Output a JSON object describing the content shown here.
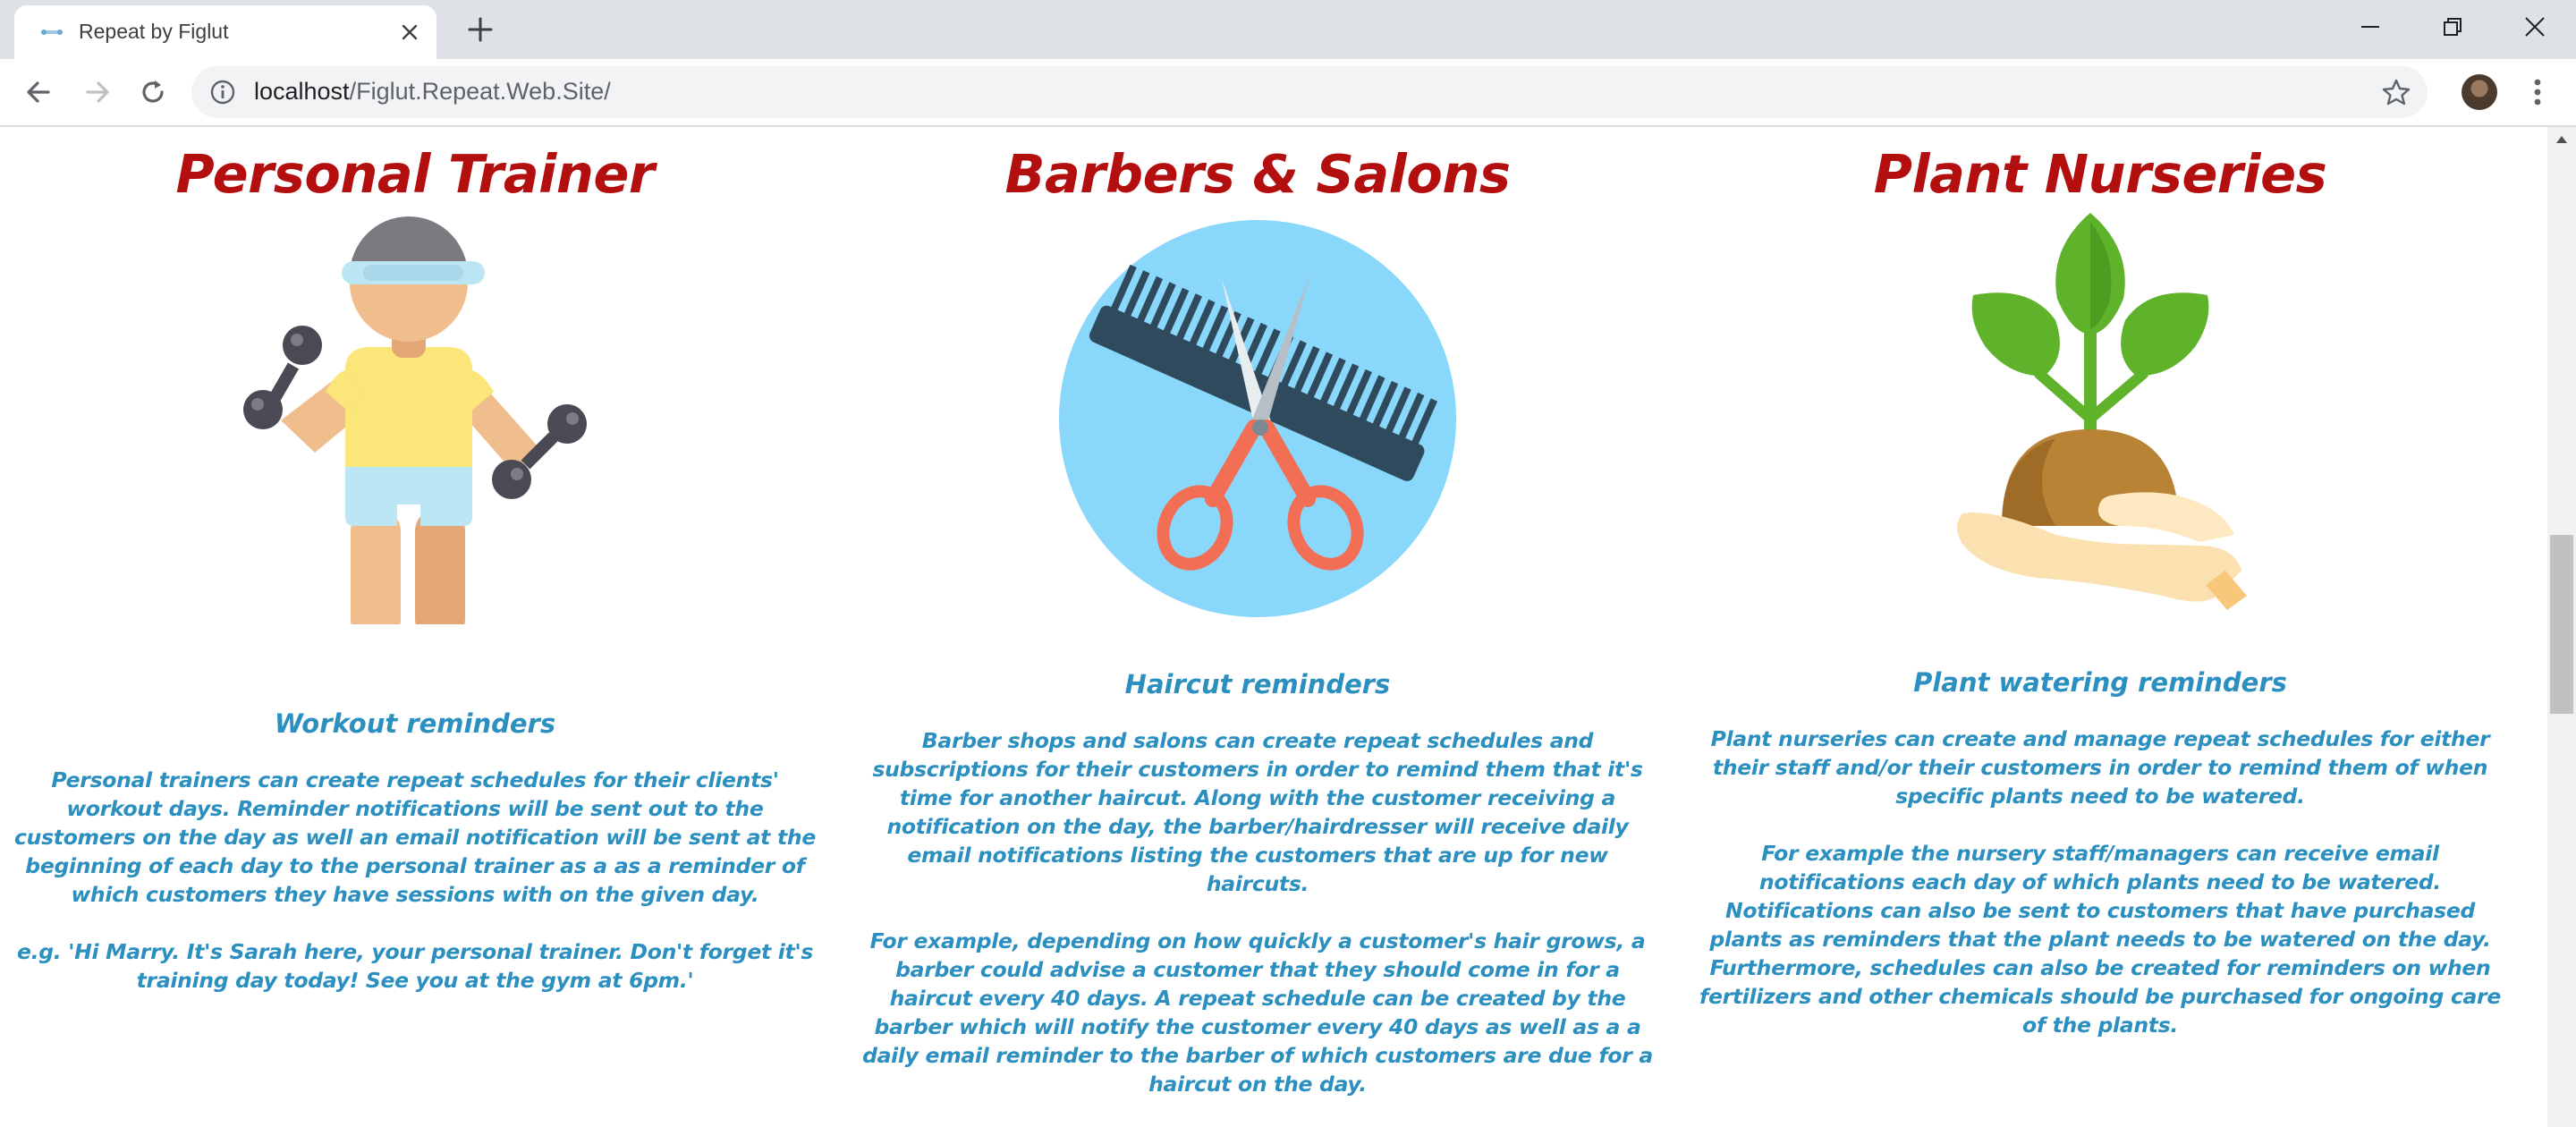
{
  "browser": {
    "tab_title": "Repeat by Figlut",
    "url_host": "localhost",
    "url_path": "/Figlut.Repeat.Web.Site/"
  },
  "sections": [
    {
      "title": "Personal Trainer",
      "illustration": "fitness-person-with-dumbbells-icon",
      "subtitle": "Workout reminders",
      "paragraphs": [
        "Personal trainers can create repeat schedules for their clients' workout days. Reminder notifications will be sent out to the customers on the day as well an email notification will be sent at the beginning of each day to the personal trainer as a as a reminder of which customers they have sessions with on the given day.",
        "e.g. 'Hi Marry. It's Sarah here, your personal trainer. Don't forget it's training day today! See you at the gym at 6pm.'"
      ]
    },
    {
      "title": "Barbers & Salons",
      "illustration": "comb-and-scissors-icon",
      "subtitle": "Haircut reminders",
      "paragraphs": [
        "Barber shops and salons can create repeat schedules and subscriptions for their customers in order to remind them that it's time for another haircut. Along with the customer receiving a notification on the day, the barber/hairdresser will receive daily email notifications listing the customers that are up for new haircuts.",
        "For example, depending on how quickly a customer's hair grows, a barber could advise a customer that they should come in for a haircut every 40 days. A repeat schedule can be created by the barber which will notify the customer every 40 days as well as a a daily email reminder to the barber of which customers are due for a haircut on the day."
      ]
    },
    {
      "title": "Plant Nurseries",
      "illustration": "plant-in-hand-icon",
      "subtitle": "Plant watering reminders",
      "paragraphs": [
        "Plant nurseries can create and manage repeat schedules for either their staff and/or their customers in order to remind them of when specific plants need to be watered.",
        "For example the nursery staff/managers can receive email notifications each day of which plants need to be watered. Notifications can also be sent to customers that have purchased plants as reminders that the plant needs to be watered on the day. Furthermore, schedules can also be created for reminders on when fertilizers and other chemicals should be purchased for ongoing care of the plants."
      ]
    }
  ],
  "colors": {
    "heading": "#b30f0f",
    "body_text": "#2b8fc0"
  }
}
